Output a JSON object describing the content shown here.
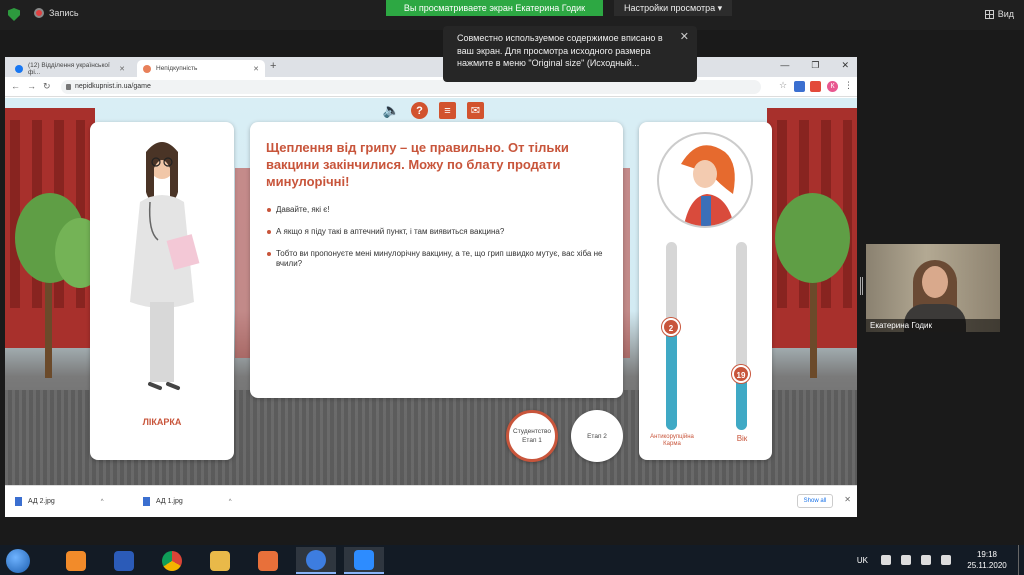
{
  "zoom": {
    "recording_label": "Запись",
    "viewing_banner": "Вы просматриваете экран Екатерина Годик",
    "view_settings": "Настройки просмотра",
    "view_button": "Вид",
    "tooltip_text": "Совместно используемое содержимое вписано в ваш экран. Для просмотра исходного размера нажмите в меню \"Original size\" (Исходный...",
    "participant_name": "Екатерина Годик"
  },
  "browser": {
    "tabs": [
      {
        "label": "(12) Відділення української фі...",
        "favicon_color": "#1877f2"
      },
      {
        "label": "Непідкупність",
        "favicon_color": "#e8805a"
      }
    ],
    "url": "nepidkupnist.in.ua/game",
    "profile_initial": "К"
  },
  "game": {
    "character_label": "ЛІКАРКА",
    "question": "Щеплення від грипу – це правильно. От тільки вакцини закінчилися. Можу по блату продати минулорічні!",
    "answers": [
      "Давайте, які є!",
      "А якщо я піду такі в аптечний пункт, і там виявиться вакцина?",
      "Тобто ви пропонуєте мені минулорічну вакцину, а те, що грип швидко мутує, вас хіба не вчили?"
    ],
    "stages": [
      {
        "title": "Студентство",
        "sub": "Етап 1",
        "active": true
      },
      {
        "title": "",
        "sub": "Етап 2",
        "active": false
      }
    ],
    "karma": {
      "label": "Антикорупційна Карма",
      "value": 2,
      "fill": 0.55
    },
    "age": {
      "label": "Вік",
      "value": 19,
      "fill": 0.3
    },
    "accent": "#c8553b",
    "bar_color": "#3fa9c5"
  },
  "downloads": {
    "files": [
      "АД 2.jpg",
      "АД 1.jpg"
    ],
    "show_all": "Show all"
  },
  "taskbar": {
    "lang": "UK",
    "time": "19:18",
    "date": "25.11.2020"
  }
}
